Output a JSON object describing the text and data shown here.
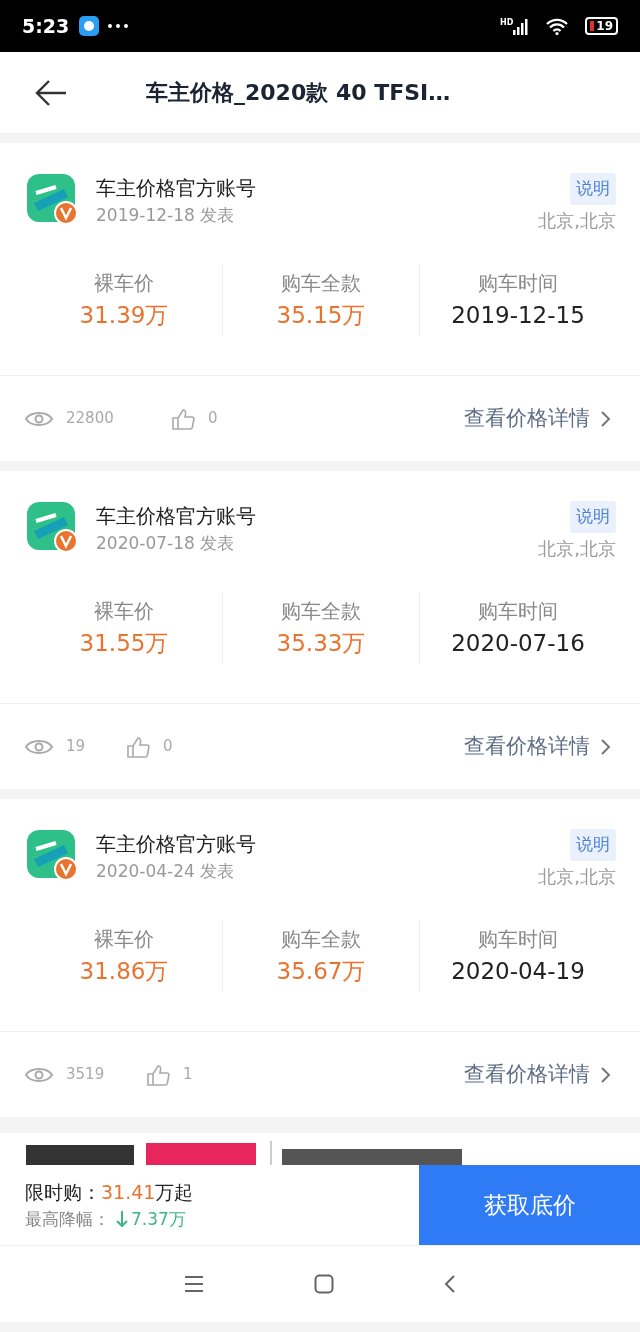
{
  "status_bar": {
    "time": "5:23",
    "network": "HD",
    "battery": "19"
  },
  "header": {
    "title": "车主价格_2020款 40 TFSI…"
  },
  "posts": [
    {
      "author": "车主价格官方账号",
      "date": "2019-12-18 发表",
      "tag": "说明",
      "location": "北京,北京",
      "stats": [
        {
          "label": "裸车价",
          "value": "31.39万",
          "kind": "price"
        },
        {
          "label": "购车全款",
          "value": "35.15万",
          "kind": "price"
        },
        {
          "label": "购车时间",
          "value": "2019-12-15",
          "kind": "date"
        }
      ],
      "views": "22800",
      "likes": "0",
      "link": "查看价格详情"
    },
    {
      "author": "车主价格官方账号",
      "date": "2020-07-18 发表",
      "tag": "说明",
      "location": "北京,北京",
      "stats": [
        {
          "label": "裸车价",
          "value": "31.55万",
          "kind": "price"
        },
        {
          "label": "购车全款",
          "value": "35.33万",
          "kind": "price"
        },
        {
          "label": "购车时间",
          "value": "2020-07-16",
          "kind": "date"
        }
      ],
      "views": "19",
      "likes": "0",
      "link": "查看价格详情"
    },
    {
      "author": "车主价格官方账号",
      "date": "2020-04-24 发表",
      "tag": "说明",
      "location": "北京,北京",
      "stats": [
        {
          "label": "裸车价",
          "value": "31.86万",
          "kind": "price"
        },
        {
          "label": "购车全款",
          "value": "35.67万",
          "kind": "price"
        },
        {
          "label": "购车时间",
          "value": "2020-04-19",
          "kind": "date"
        }
      ],
      "views": "3519",
      "likes": "1",
      "link": "查看价格详情"
    }
  ],
  "bottom_bar": {
    "label": "限时购：",
    "price": "31.41",
    "price_suffix": "万起",
    "drop_label": "最高降幅：",
    "drop": "7.37万",
    "button": "获取底价"
  }
}
